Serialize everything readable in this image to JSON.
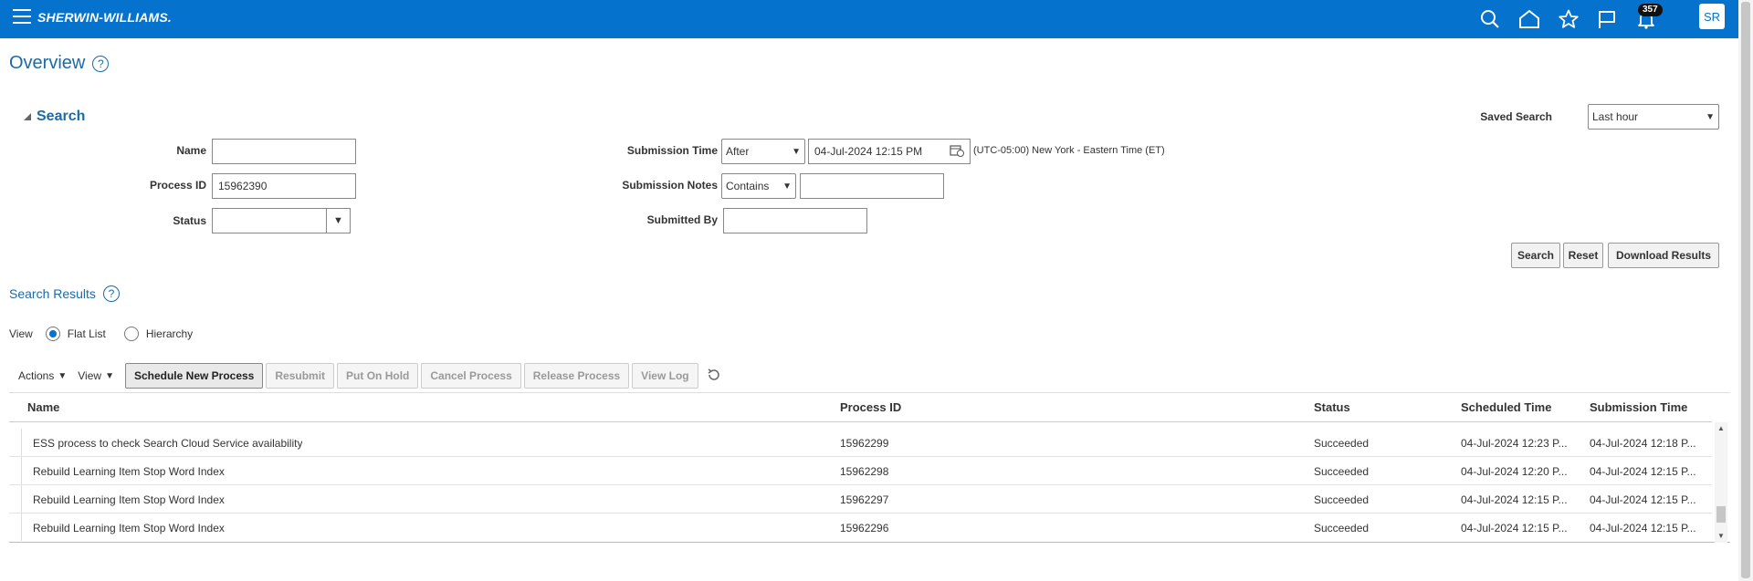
{
  "header": {
    "brand": "SHERWIN-WILLIAMS.",
    "notification_count": "357",
    "avatar_initials": "SR"
  },
  "page": {
    "title": "Overview",
    "help_glyph": "?"
  },
  "search": {
    "title": "Search",
    "saved_search_label": "Saved Search",
    "saved_search_value": "Last hour",
    "name_label": "Name",
    "name_value": "",
    "process_id_label": "Process ID",
    "process_id_value": "15962390",
    "status_label": "Status",
    "status_value": "",
    "submission_time_label": "Submission Time",
    "submission_time_operator": "After",
    "submission_time_value": "04-Jul-2024 12:15 PM",
    "timezone": "(UTC-05:00) New York - Eastern Time (ET)",
    "submission_notes_label": "Submission Notes",
    "submission_notes_operator": "Contains",
    "submission_notes_value": "",
    "submitted_by_label": "Submitted By",
    "submitted_by_value": "",
    "buttons": {
      "search": "Search",
      "reset": "Reset",
      "download": "Download Results"
    }
  },
  "results": {
    "title": "Search Results",
    "view_label": "View",
    "view_options": [
      "Flat List",
      "Hierarchy"
    ],
    "view_selected": "Flat List",
    "toolbar": {
      "actions": "Actions",
      "view": "View",
      "schedule": "Schedule New Process",
      "resubmit": "Resubmit",
      "put_on_hold": "Put On Hold",
      "cancel": "Cancel Process",
      "release": "Release Process",
      "view_log": "View Log"
    },
    "columns": [
      "Name",
      "Process ID",
      "Status",
      "Scheduled Time",
      "Submission Time"
    ],
    "rows": [
      {
        "name": "ESS process to check Search Cloud Service availability",
        "process_id": "15962299",
        "status": "Succeeded",
        "scheduled": "04-Jul-2024 12:23 P...",
        "submitted": "04-Jul-2024 12:18 P..."
      },
      {
        "name": "Rebuild Learning Item Stop Word Index",
        "process_id": "15962298",
        "status": "Succeeded",
        "scheduled": "04-Jul-2024 12:20 P...",
        "submitted": "04-Jul-2024 12:15 P..."
      },
      {
        "name": "Rebuild Learning Item Stop Word Index",
        "process_id": "15962297",
        "status": "Succeeded",
        "scheduled": "04-Jul-2024 12:15 P...",
        "submitted": "04-Jul-2024 12:15 P..."
      },
      {
        "name": "Rebuild Learning Item Stop Word Index",
        "process_id": "15962296",
        "status": "Succeeded",
        "scheduled": "04-Jul-2024 12:15 P...",
        "submitted": "04-Jul-2024 12:15 P..."
      }
    ]
  },
  "icons": {
    "menu": "hamburger-icon",
    "search": "search-icon",
    "home": "home-icon",
    "favorites": "star-icon",
    "flag": "flag-icon",
    "notifications": "bell-icon",
    "calendar": "calendar-icon",
    "refresh": "refresh-icon"
  },
  "colors": {
    "brand_bar": "#0572ce",
    "link": "#1a6ba8"
  }
}
